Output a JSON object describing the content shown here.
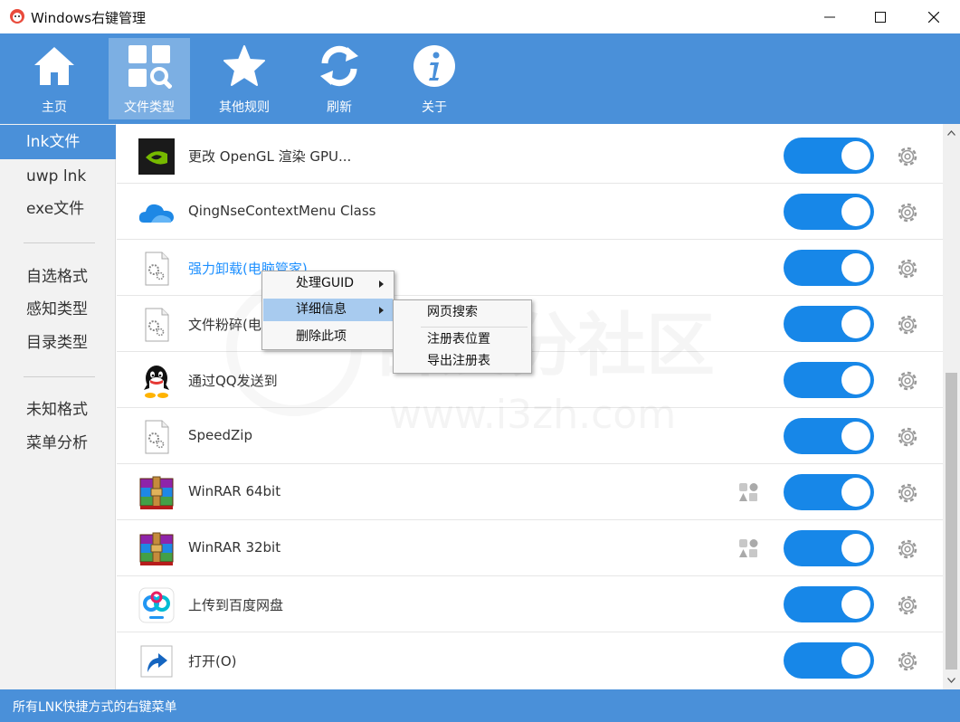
{
  "window": {
    "title": "Windows右键管理"
  },
  "toolbar": {
    "items": [
      {
        "label": "主页",
        "icon": "home-icon"
      },
      {
        "label": "文件类型",
        "icon": "file-type-icon"
      },
      {
        "label": "其他规则",
        "icon": "star-icon"
      },
      {
        "label": "刷新",
        "icon": "refresh-icon"
      },
      {
        "label": "关于",
        "icon": "info-icon"
      }
    ],
    "active_index": 1
  },
  "sidebar": {
    "items": [
      "lnk文件",
      "uwp lnk",
      "exe文件",
      "自选格式",
      "感知类型",
      "目录类型",
      "未知格式",
      "菜单分析"
    ],
    "active_index": 0
  },
  "list": {
    "rows": [
      {
        "label": "更改 OpenGL 渲染 GPU...",
        "icon": "nvidia-icon",
        "enabled": true
      },
      {
        "label": "QingNseContextMenu Class",
        "icon": "cloud-icon",
        "enabled": true
      },
      {
        "label": "强力卸载(电脑管家)",
        "icon": "gear-file-icon",
        "enabled": true
      },
      {
        "label": "文件粉碎(电",
        "icon": "gear-file-icon",
        "enabled": true
      },
      {
        "label": "通过QQ发送到",
        "icon": "qq-icon",
        "enabled": true
      },
      {
        "label": "SpeedZip",
        "icon": "gear-file-icon",
        "enabled": true
      },
      {
        "label": "WinRAR 64bit",
        "icon": "winrar-icon",
        "enabled": true
      },
      {
        "label": "WinRAR 32bit",
        "icon": "winrar-icon",
        "enabled": true
      },
      {
        "label": "上传到百度网盘",
        "icon": "baidu-netdisk-icon",
        "enabled": true
      },
      {
        "label": "打开(O)",
        "icon": "shortcut-arrow-icon",
        "enabled": true
      }
    ]
  },
  "context_menu": {
    "items": [
      "处理GUID",
      "详细信息",
      "删除此项"
    ],
    "highlighted_index": 1
  },
  "submenu": {
    "items": [
      "网页搜索",
      "注册表位置",
      "导出注册表"
    ]
  },
  "statusbar": {
    "text": "所有LNK快捷方式的右键菜单"
  },
  "watermark": {
    "text": "吾爱分社区",
    "url": "www.i3zh.com"
  },
  "colors": {
    "accent": "#4a90d9",
    "toggle_on": "#1787e8",
    "link": "#1e90ff"
  }
}
